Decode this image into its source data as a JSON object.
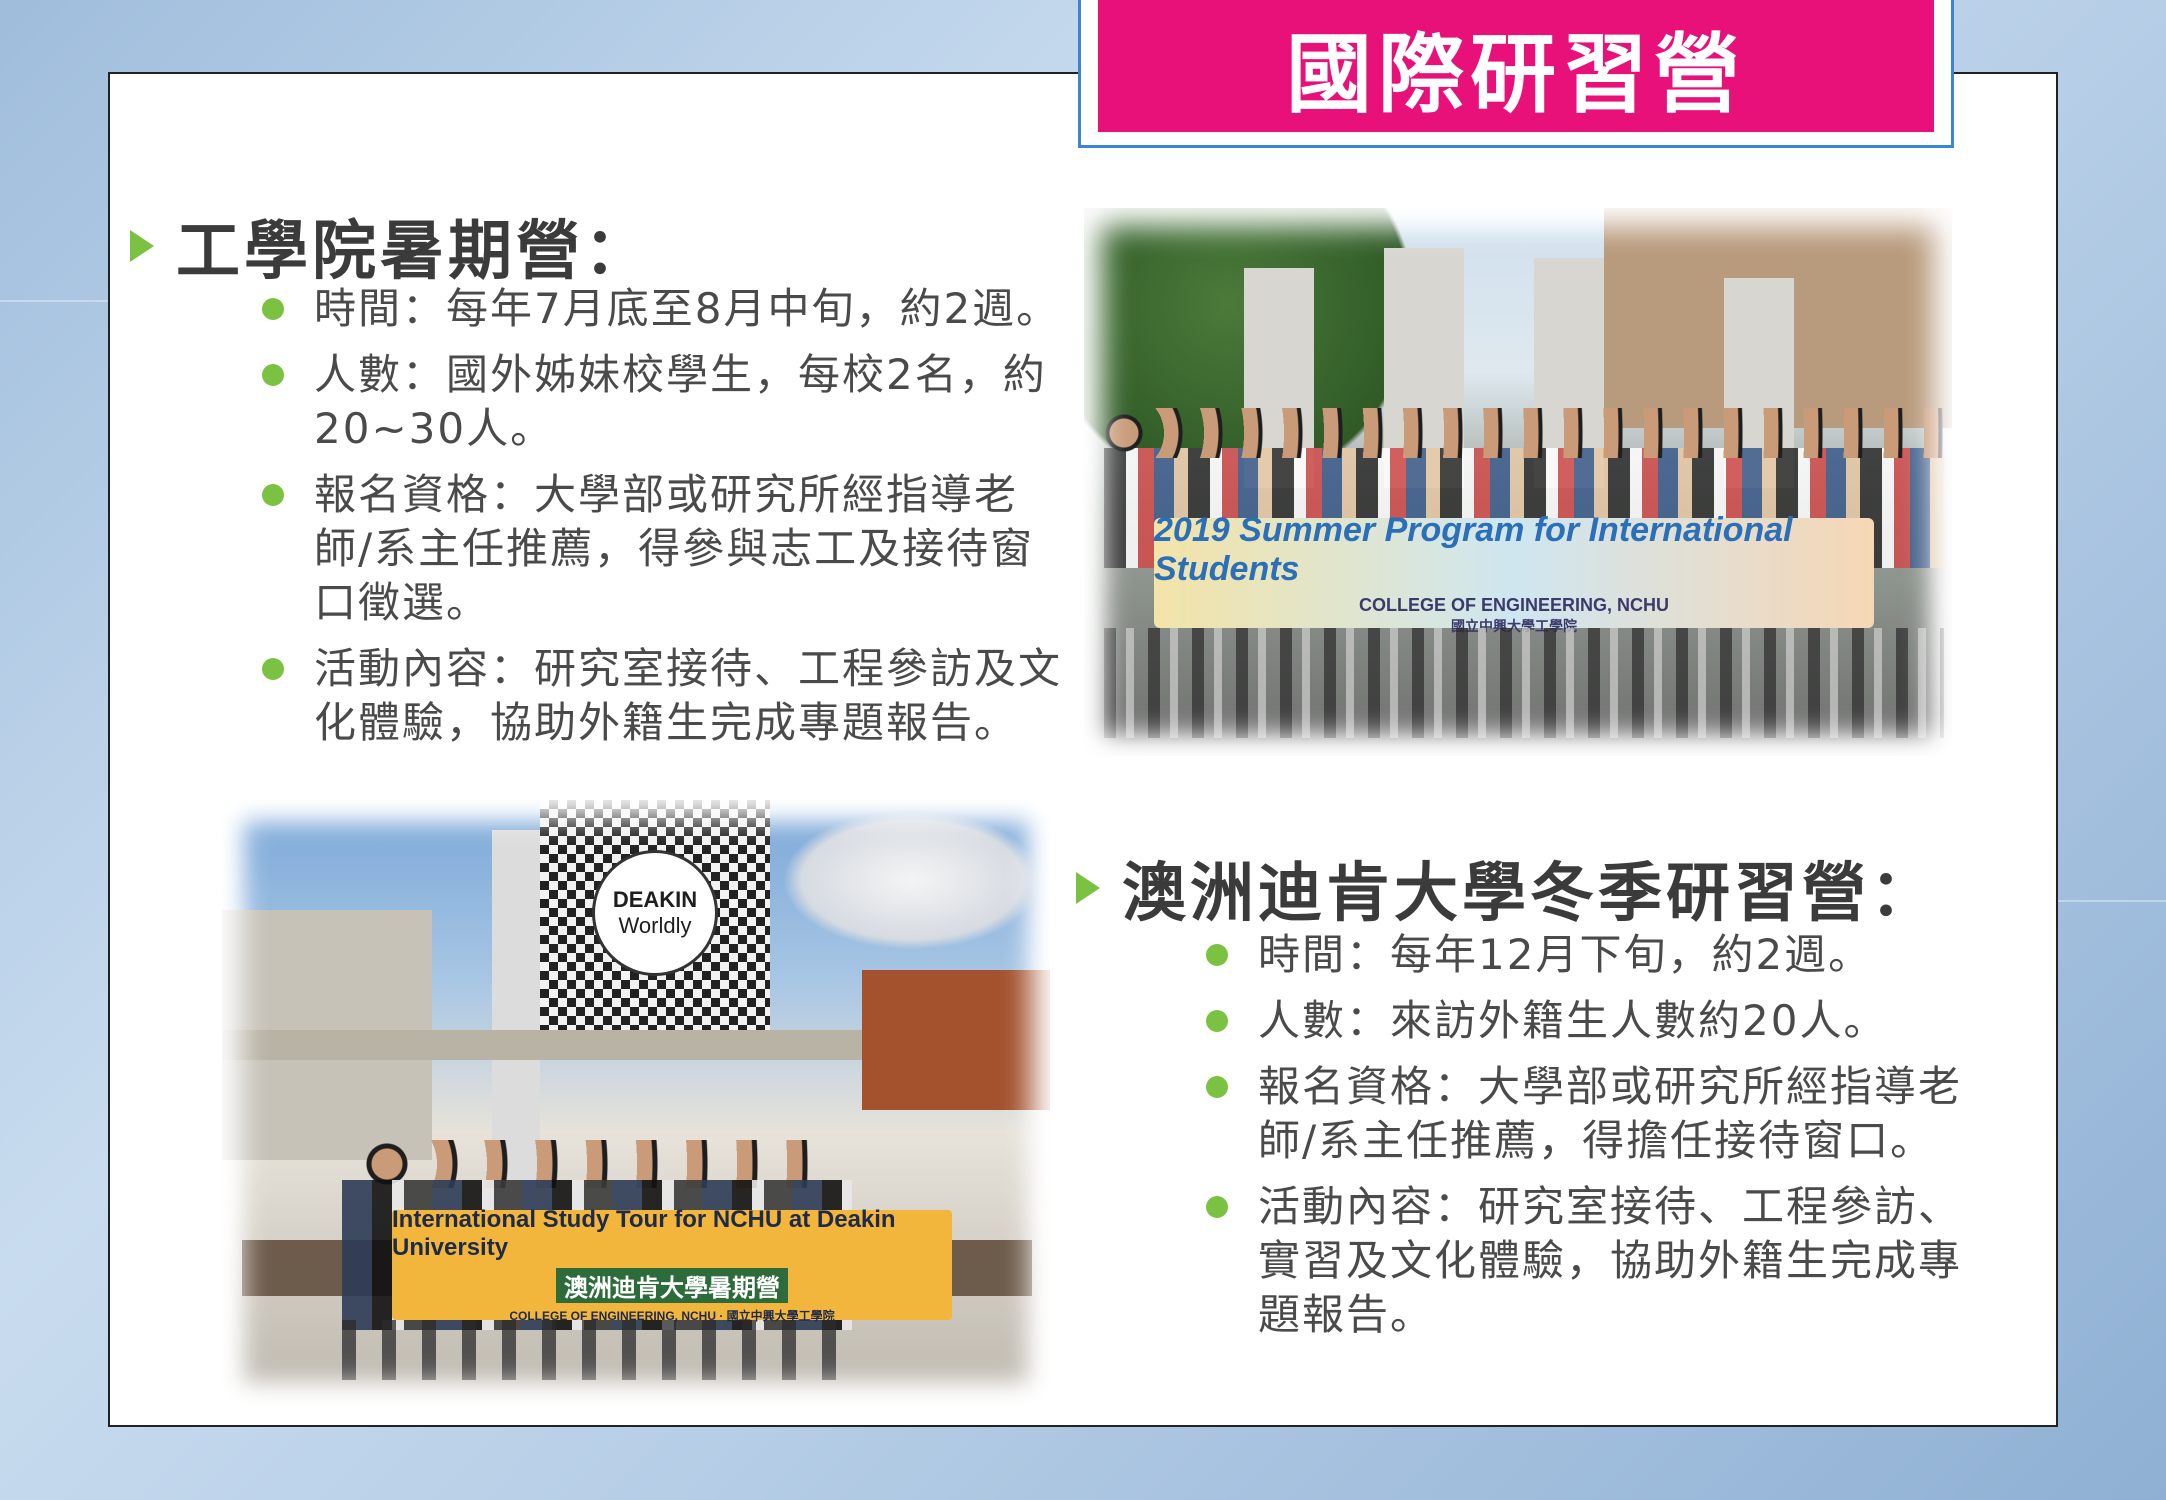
{
  "title": "國際研習營",
  "section1": {
    "heading": "工學院暑期營：",
    "bullets": [
      "時間：每年7月底至8月中旬，約2週。",
      "人數：國外姊妹校學生，每校2名，約20~30人。",
      "報名資格：大學部或研究所經指導老師/系主任推薦，得參與志工及接待窗口徵選。",
      "活動內容：研究室接待、工程參訪及文化體驗，協助外籍生完成專題報告。"
    ]
  },
  "section2": {
    "heading": "澳洲迪肯大學冬季研習營：",
    "bullets": [
      "時間：每年12月下旬，約2週。",
      "人數：來訪外籍生人數約20人。",
      "報名資格：大學部或研究所經指導老師/系主任推薦，得擔任接待窗口。",
      "活動內容：研究室接待、工程參訪、實習及文化體驗，協助外籍生完成專題報告。"
    ]
  },
  "photo1": {
    "banner_line1": "2019 Summer Program for International Students",
    "banner_line2": "COLLEGE OF ENGINEERING, NCHU",
    "banner_line3": "國立中興大學工學院"
  },
  "photo2": {
    "sign_line1": "DEAKIN",
    "sign_line2": "Worldly",
    "banner_line1": "International Study Tour for NCHU at Deakin University",
    "banner_line2": "澳洲迪肯大學暑期營",
    "banner_line3": "COLLEGE OF ENGINEERING, NCHU · 國立中興大學工學院"
  },
  "colors": {
    "accent": "#e8117a",
    "bullet": "#7cc242",
    "frame": "#3a86d6"
  }
}
